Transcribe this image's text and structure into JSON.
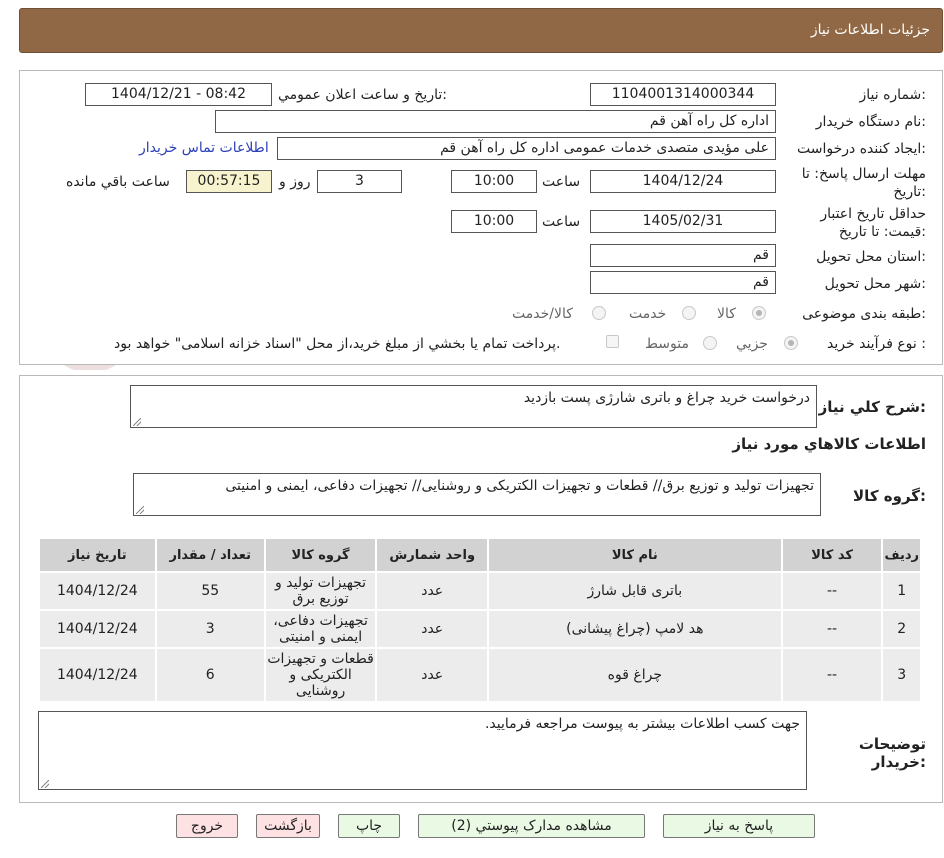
{
  "header": {
    "title": "جزئیات اطلاعات نیاز"
  },
  "fields": {
    "need_number_label": "شماره نیاز:",
    "need_number": "1104001314000344",
    "announce_label": "تاریخ و ساعت اعلان عمومي:",
    "announce_value": "1404/12/21 - 08:42",
    "buyer_org_label": "نام دستگاه خريدار:",
    "buyer_org": "اداره کل  راه آهن قم",
    "requester_label": "ایجاد کننده درخواست:",
    "requester": "علی مؤیدی متصدی خدمات عمومی اداره کل  راه آهن قم",
    "contact_link": "اطلاعات تماس خریدار",
    "deadline_label_1": "مهلت ارسال پاسخ: تا",
    "deadline_label_2": "تاریخ:",
    "deadline_date": "1404/12/24",
    "time_label": "ساعت",
    "deadline_time": "10:00",
    "days_value": "3",
    "days_label": "روز و",
    "remaining_time": "00:57:15",
    "remaining_label": "ساعت باقي مانده",
    "validity_label_1": "حداقل تاريخ اعتبار",
    "validity_label_2": "قيمت: تا تاريخ:",
    "validity_date": "1405/02/31",
    "validity_time_label": "ساعت",
    "validity_time": "10:00",
    "province_label": "استان محل تحويل:",
    "province": "قم",
    "city_label": "شهر محل تحويل:",
    "city": "قم",
    "category_label": "طبقه بندی موضوعی:",
    "category_options": [
      "کالا",
      "خدمت",
      "کالا/خدمت"
    ],
    "process_label": "نوع فرآيند خريد :",
    "process_options": [
      "جزيي",
      "متوسط"
    ],
    "payment_note": "پرداخت تمام يا بخشي از مبلغ خريد،از محل \"اسناد خزانه اسلامی\" خواهد بود."
  },
  "summary": {
    "label": "شرح کلي نياز:",
    "value": "درخواست خرید چراغ و باتری شارژی پست بازدید",
    "goods_title": "اطلاعات کالاهاي مورد نياز",
    "group_label": "گروه کالا:",
    "group_value": "تجهیزات تولید و توزیع برق// قطعات و تجهیزات الکتریکی و روشنایی// تجهیزات دفاعی، ایمنی و امنیتی"
  },
  "table": {
    "headers": [
      "رديف",
      "کد کالا",
      "نام کالا",
      "واحد شمارش",
      "گروه کالا",
      "تعداد / مقدار",
      "تاريخ نياز"
    ],
    "rows": [
      {
        "n": "1",
        "code": "--",
        "name": "باتری قابل شارژ",
        "unit": "عدد",
        "group": "تجهیزات تولید و توزیع برق",
        "qty": "55",
        "date": "1404/12/24"
      },
      {
        "n": "2",
        "code": "--",
        "name": "هد لامپ (چراغ پیشانی)",
        "unit": "عدد",
        "group": "تجهیزات دفاعی، ایمنی و امنیتی",
        "qty": "3",
        "date": "1404/12/24"
      },
      {
        "n": "3",
        "code": "--",
        "name": "چراغ قوه",
        "unit": "عدد",
        "group": "قطعات و تجهیزات الکتریکی و روشنایی",
        "qty": "6",
        "date": "1404/12/24"
      }
    ]
  },
  "notes": {
    "label_1": "توضيحات",
    "label_2": "خريدار:",
    "value": "جهت کسب اطلاعات بیشتر به پیوست مراجعه فرمایید."
  },
  "buttons": {
    "reply": "پاسخ به نياز",
    "attachments": "مشاهده مدارک پيوستي (2)",
    "print": "چاپ",
    "back": "بازگشت",
    "exit": "خروج"
  },
  "watermark": {
    "text": "AriaTender.neT"
  },
  "colors": {
    "header": "#906845",
    "green_button": "#e9f9e4",
    "pink_button": "#fde1e3",
    "remaining_bg": "#f8f3cf"
  }
}
